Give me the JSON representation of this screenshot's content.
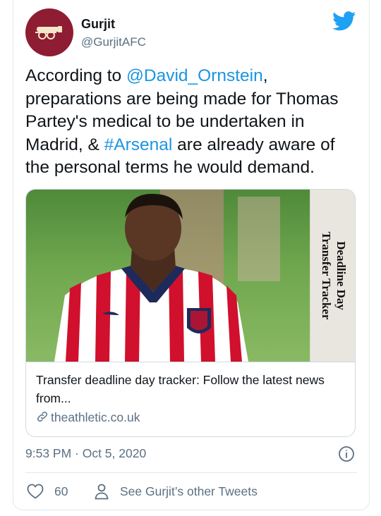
{
  "author": {
    "name": "Gurjit",
    "handle": "@GurjitAFC",
    "avatar_color": "#8e1d33"
  },
  "icons": {
    "brand": "twitter-bird-icon",
    "avatar": "cannon-crest-icon",
    "link": "chain-link-icon",
    "info": "info-icon",
    "like": "heart-icon",
    "profile": "person-icon"
  },
  "tweet": {
    "line1_pre": "According to ",
    "mention": "@David_Ornstein",
    "line1_post": ",",
    "body_1": "preparations are being made for Thomas Partey's medical to be undertaken in Madrid, & ",
    "hashtag": "#Arsenal",
    "body_2": " are already aware of the personal terms he would demand."
  },
  "link_card": {
    "sidebar_line1": "Deadline Day",
    "sidebar_line2": "Transfer Tracker",
    "title": "Transfer deadline day tracker: Follow the latest news from...",
    "domain": "theathletic.co.uk"
  },
  "meta": {
    "timestamp": "9:53 PM · Oct 5, 2020"
  },
  "actions": {
    "like_count": "60",
    "other_tweets": "See Gurjit’s other Tweets"
  },
  "colors": {
    "link": "#1b95e0",
    "twitter_blue": "#1da1f2",
    "secondary_text": "#5b7083",
    "border": "#e1e8ed"
  }
}
